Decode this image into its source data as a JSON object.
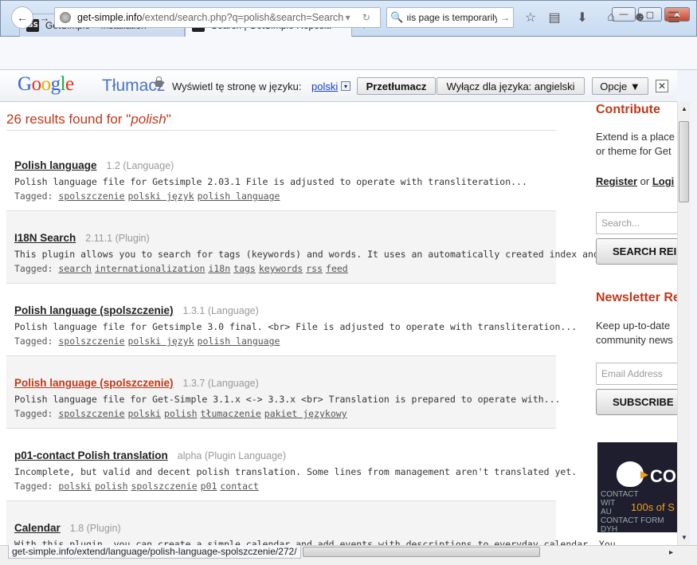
{
  "browser": {
    "tabs": [
      {
        "favicon": "GS",
        "title": "GetSimple » Installation",
        "close": "✕"
      },
      {
        "favicon": "GS",
        "title": "Search | GetSimple Reposit...",
        "close": "✕"
      }
    ],
    "new_tab": "+",
    "window_buttons": {
      "minimize": "—",
      "maximize": "▢",
      "close": "✕"
    },
    "nav": {
      "back": "←",
      "forward": "→"
    },
    "url": {
      "domain": "get-simple.info",
      "path": "/extend/search.php?q=polish&search=Search",
      "tools": "▾ ↻"
    },
    "search": {
      "icon": "🔍",
      "value": "ıis page is temporarily",
      "go": "→"
    },
    "toolbar_icons": [
      "star-icon",
      "reading-list-icon",
      "download-icon",
      "home-icon",
      "smiley-icon",
      "menu-icon"
    ],
    "toolbar_glyphs": {
      "star": "☆",
      "list": "▤",
      "download": "⬇",
      "home": "⌂",
      "smiley": "☻",
      "menu": "☰"
    }
  },
  "translate_bar": {
    "logo_letters": [
      "G",
      "o",
      "o",
      "g",
      "l",
      "e"
    ],
    "product": "Tłumacz",
    "prompt": "Wyświetl tę stronę w języku:",
    "language": "polski",
    "dropdown": "▾",
    "translate_button": "Przetłumacz",
    "disable_button": "Wyłącz dla języka: angielski",
    "options_button": "Opcje ▼",
    "close": "✕"
  },
  "results": {
    "count_text": "26 results found for \"",
    "query": "polish",
    "close_quote": "\"",
    "items": [
      {
        "title": "Polish language",
        "meta": "1.2 (Language)",
        "desc": "Polish language file for Getsimple 2.03.1 File is adjusted to operate with transliteration...",
        "tagged": "Tagged:",
        "tags": [
          "spolszczenie",
          "polski język",
          "polish language"
        ]
      },
      {
        "title": "I18N Search",
        "meta": "2.11.1 (Plugin)",
        "desc": "This plugin allows you to search for tags (keywords) and words. It uses an automatically created index and...",
        "tagged": "Tagged:",
        "tags": [
          "search",
          "internationalization",
          "i18n",
          "tags",
          "keywords",
          "rss",
          "feed"
        ]
      },
      {
        "title": "Polish language (spolszczenie)",
        "meta": "1.3.1 (Language)",
        "desc": "Polish language file for Getsimple 3.0 final. <br> File is adjusted to operate with transliteration...",
        "tagged": "Tagged:",
        "tags": [
          "spolszczenie",
          "polski język",
          "polish language"
        ]
      },
      {
        "title": "Polish language (spolszczenie)",
        "meta": "1.3.7 (Language)",
        "desc": "Polish language file for Get-Simple 3.1.x <-> 3.3.x <br> Translation is prepared to operate with...",
        "tagged": "Tagged:",
        "tags": [
          "spolszczenie",
          "polski",
          "polish",
          "tłumaczenie",
          "pakiet językowy"
        ]
      },
      {
        "title": "p01-contact Polish translation",
        "meta": "alpha (Plugin Language)",
        "desc": "Incomplete, but valid and decent polish translation. Some lines from management aren't translated yet.",
        "tagged": "Tagged:",
        "tags": [
          "polski",
          "polish",
          "spolszczenie",
          "p01",
          "contact"
        ]
      },
      {
        "title": "Calendar",
        "meta": "1.8 (Plugin)",
        "desc": "With this plugin, you can create a simple calendar and add events with descriptions to everyday calendar. You...",
        "tagged": "",
        "tags": []
      }
    ]
  },
  "sidebar": {
    "contribute_heading": "Contribute",
    "contribute_text_1": "Extend is a place",
    "contribute_text_2": "or theme for Get",
    "register": "Register",
    "or": "or",
    "login": "Logi",
    "search_placeholder": "Search...",
    "search_button": "SEARCH REI",
    "newsletter_heading": "Newsletter Re",
    "newsletter_text_1": "Keep up-to-date",
    "newsletter_text_2": "community news",
    "email_placeholder": "Email Address",
    "subscribe_button": "SUBSCRIBE",
    "ad": {
      "brand": "CO",
      "tagline": "100s of S",
      "small": "CONTACT\nWIT\nAU\nCONTACT FORM\nDYH\nPHP"
    }
  },
  "status": {
    "url": "get-simple.info/extend/language/polish-language-spolszczenie/272/"
  },
  "scroll": {
    "up": "▲",
    "down": "▼",
    "right": "▸"
  }
}
